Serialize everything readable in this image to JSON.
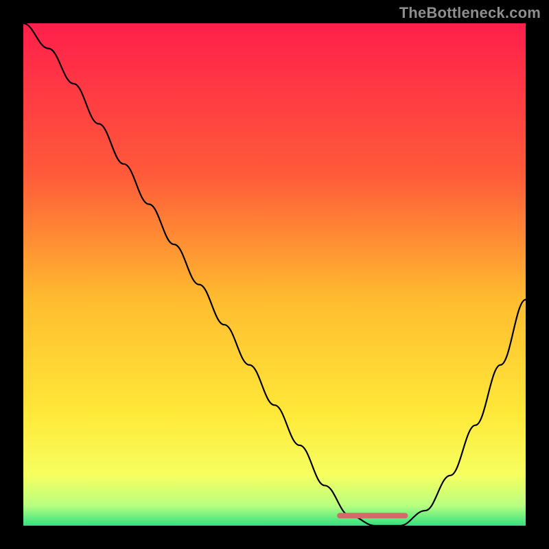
{
  "watermark": "TheBottleneck.com",
  "chart_data": {
    "type": "line",
    "title": "",
    "xlabel": "",
    "ylabel": "",
    "xlim": [
      0,
      100
    ],
    "ylim": [
      0,
      100
    ],
    "x": [
      0,
      5,
      10,
      15,
      20,
      25,
      30,
      35,
      40,
      45,
      50,
      55,
      60,
      65,
      70,
      75,
      80,
      85,
      90,
      95,
      100
    ],
    "values": [
      100,
      95,
      88,
      80,
      72,
      64,
      56,
      48,
      40,
      32,
      24,
      16,
      8,
      2,
      0,
      0,
      3,
      10,
      20,
      32,
      45
    ],
    "gradient_stops": [
      {
        "pos": 0.0,
        "color": "#ff1f4b"
      },
      {
        "pos": 0.3,
        "color": "#ff5a3a"
      },
      {
        "pos": 0.55,
        "color": "#ffbc2f"
      },
      {
        "pos": 0.78,
        "color": "#ffe939"
      },
      {
        "pos": 0.9,
        "color": "#f6ff60"
      },
      {
        "pos": 0.96,
        "color": "#b8ff80"
      },
      {
        "pos": 1.0,
        "color": "#32e080"
      }
    ],
    "highlight": {
      "color": "#d36a6a",
      "xs": [
        63,
        76
      ],
      "ys": [
        2,
        2
      ]
    }
  }
}
